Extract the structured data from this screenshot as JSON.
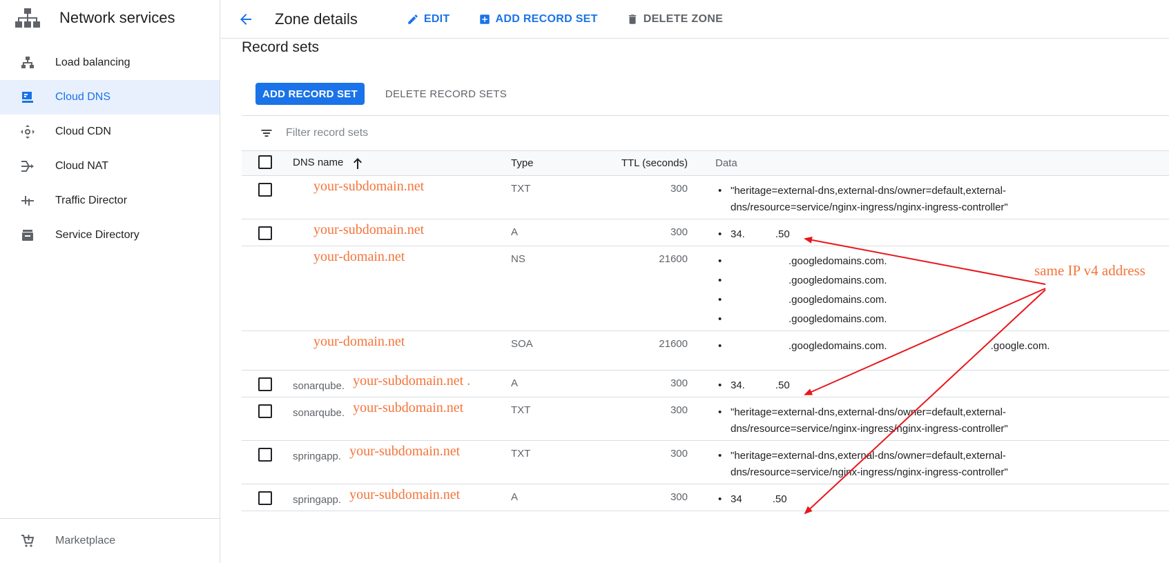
{
  "sidebar": {
    "title": "Network services",
    "items": [
      {
        "label": "Load balancing",
        "icon": "load-balancing-icon"
      },
      {
        "label": "Cloud DNS",
        "icon": "cloud-dns-icon",
        "active": true
      },
      {
        "label": "Cloud CDN",
        "icon": "cloud-cdn-icon"
      },
      {
        "label": "Cloud NAT",
        "icon": "cloud-nat-icon"
      },
      {
        "label": "Traffic Director",
        "icon": "traffic-director-icon"
      },
      {
        "label": "Service Directory",
        "icon": "service-directory-icon"
      }
    ],
    "footer": {
      "label": "Marketplace",
      "icon": "cart-icon"
    }
  },
  "topbar": {
    "title": "Zone details",
    "edit_label": "EDIT",
    "add_label": "ADD RECORD SET",
    "delete_label": "DELETE ZONE"
  },
  "main": {
    "section_title": "Record sets",
    "add_button": "ADD RECORD SET",
    "delete_button": "DELETE RECORD SETS",
    "filter_placeholder": "Filter record sets",
    "columns": {
      "name": "DNS name",
      "type": "Type",
      "ttl": "TTL (seconds)",
      "data": "Data"
    },
    "rows": [
      {
        "prefix": "",
        "name": "your-subdomain.net",
        "type": "TXT",
        "ttl": "300",
        "data": [
          "\"heritage=external-dns,external-dns/owner=default,external-dns/resource=service/nginx-ingress/nginx-ingress-controller\""
        ],
        "checkbox": true
      },
      {
        "prefix": "",
        "name": "your-subdomain.net",
        "type": "A",
        "ttl": "300",
        "data": [
          "34.",
          ".50"
        ],
        "checkbox": true
      },
      {
        "prefix": "",
        "name": "your-domain.net",
        "type": "NS",
        "ttl": "21600",
        "data": [
          ".googledomains.com.",
          ".googledomains.com.",
          ".googledomains.com.",
          ".googledomains.com."
        ],
        "checkbox": false
      },
      {
        "prefix": "",
        "name": "your-domain.net",
        "type": "SOA",
        "ttl": "21600",
        "data": [
          ".googledomains.com.",
          ".google.com."
        ],
        "checkbox": false
      },
      {
        "prefix": "sonarqube.",
        "name": "your-subdomain.net .",
        "type": "A",
        "ttl": "300",
        "data": [
          "34.",
          ".50"
        ],
        "checkbox": true
      },
      {
        "prefix": "sonarqube.",
        "name": "your-subdomain.net",
        "type": "TXT",
        "ttl": "300",
        "data": [
          "\"heritage=external-dns,external-dns/owner=default,external-dns/resource=service/nginx-ingress/nginx-ingress-controller\""
        ],
        "checkbox": true
      },
      {
        "prefix": "springapp.",
        "name": "your-subdomain.net",
        "type": "TXT",
        "ttl": "300",
        "data": [
          "\"heritage=external-dns,external-dns/owner=default,external-dns/resource=service/nginx-ingress/nginx-ingress-controller\""
        ],
        "checkbox": true
      },
      {
        "prefix": "springapp.",
        "name": "your-subdomain.net",
        "type": "A",
        "ttl": "300",
        "data": [
          "34",
          ".50"
        ],
        "checkbox": true
      }
    ]
  },
  "annotation": {
    "label": "same IP v4 address",
    "color": "#f4743b",
    "arrow_color": "#e8161b"
  },
  "colors": {
    "accent": "#1a73e8",
    "active_bg": "#e8f0fe",
    "divider": "#dadce0"
  }
}
